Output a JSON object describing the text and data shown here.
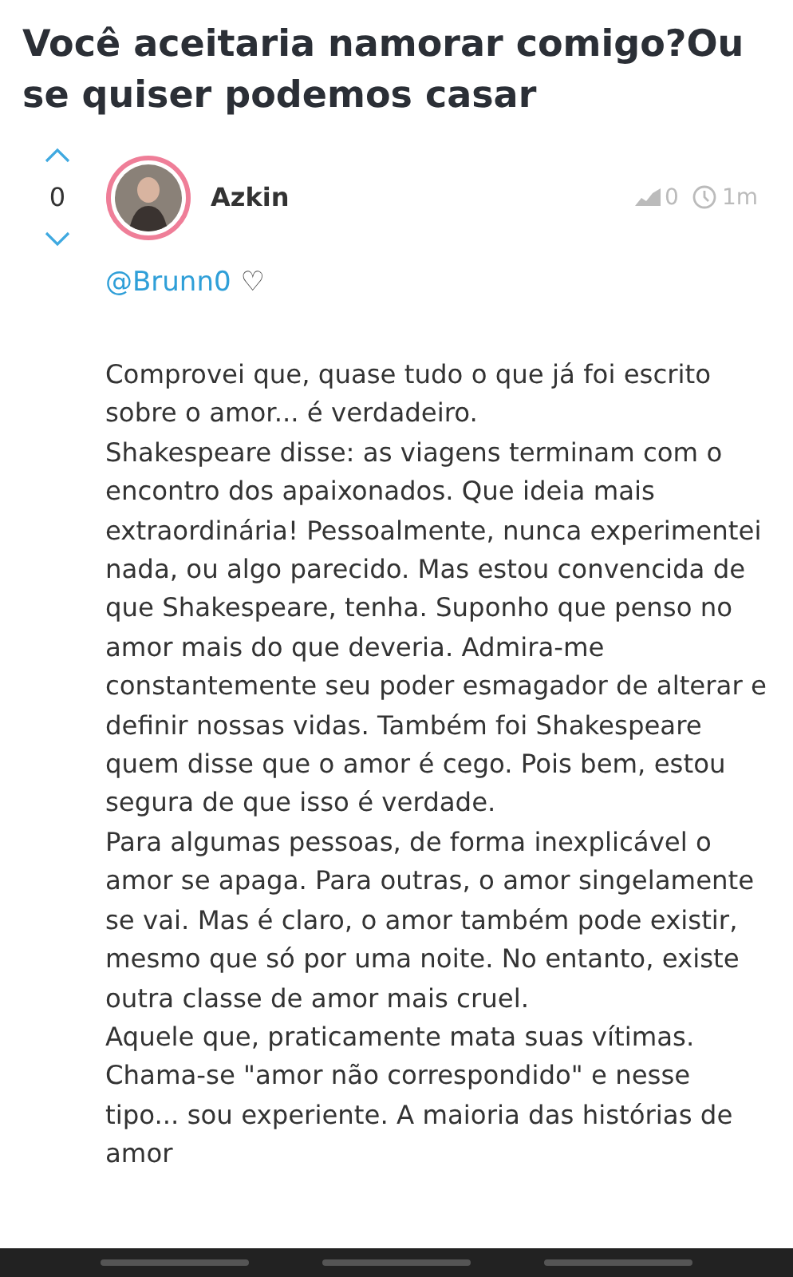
{
  "title": "Você aceitaria namorar comigo?Ou se quiser podemos casar",
  "post": {
    "score": "0",
    "author": "Azkin",
    "views": "0",
    "time": "1m",
    "mention": "@Brunn0",
    "heart": "♡",
    "paragraphs": [
      "Comprovei que, quase tudo o que já foi escrito sobre o amor... é verdadeiro.",
      "Shakespeare disse: as viagens terminam com o encontro dos apaixonados. Que ideia mais extraordinária! Pessoalmente, nunca experimentei nada, ou algo parecido. Mas estou convencida de que Shakespeare, tenha. Suponho que penso no amor mais do que deveria. Admira-me constantemente seu poder esmagador de alterar e definir nossas vidas. Também foi Shakespeare quem disse que o amor é cego. Pois bem, estou segura de que isso é verdade.",
      "Para algumas pessoas, de forma inexplicável o amor se apaga. Para outras, o amor singelamente se vai. Mas é claro, o amor também pode existir, mesmo que só por uma noite. No entanto, existe outra classe de amor mais cruel.",
      "Aquele que, praticamente mata suas vítimas.",
      "Chama-se \"amor não correspondido\" e nesse tipo... sou experiente. A maioria das histórias de amor"
    ]
  }
}
